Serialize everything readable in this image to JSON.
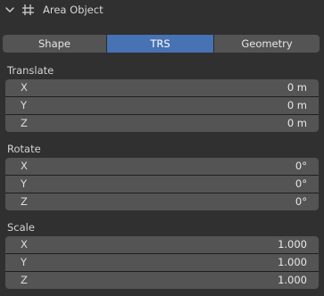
{
  "panel": {
    "title": "Area Object",
    "expand_icon": "chevron-down-icon",
    "object_icon": "hash-grid-icon"
  },
  "tabs": [
    {
      "label": "Shape",
      "active": false
    },
    {
      "label": "TRS",
      "active": true
    },
    {
      "label": "Geometry",
      "active": false
    }
  ],
  "translate": {
    "label": "Translate",
    "fields": [
      {
        "label": "X",
        "value": "0 m"
      },
      {
        "label": "Y",
        "value": "0 m"
      },
      {
        "label": "Z",
        "value": "0 m"
      }
    ]
  },
  "rotate": {
    "label": "Rotate",
    "fields": [
      {
        "label": "X",
        "value": "0°"
      },
      {
        "label": "Y",
        "value": "0°"
      },
      {
        "label": "Z",
        "value": "0°"
      }
    ]
  },
  "scale": {
    "label": "Scale",
    "fields": [
      {
        "label": "X",
        "value": "1.000"
      },
      {
        "label": "Y",
        "value": "1.000"
      },
      {
        "label": "Z",
        "value": "1.000"
      }
    ]
  },
  "colors": {
    "background": "#303030",
    "field": "#545454",
    "active_tab": "#4772b3"
  }
}
